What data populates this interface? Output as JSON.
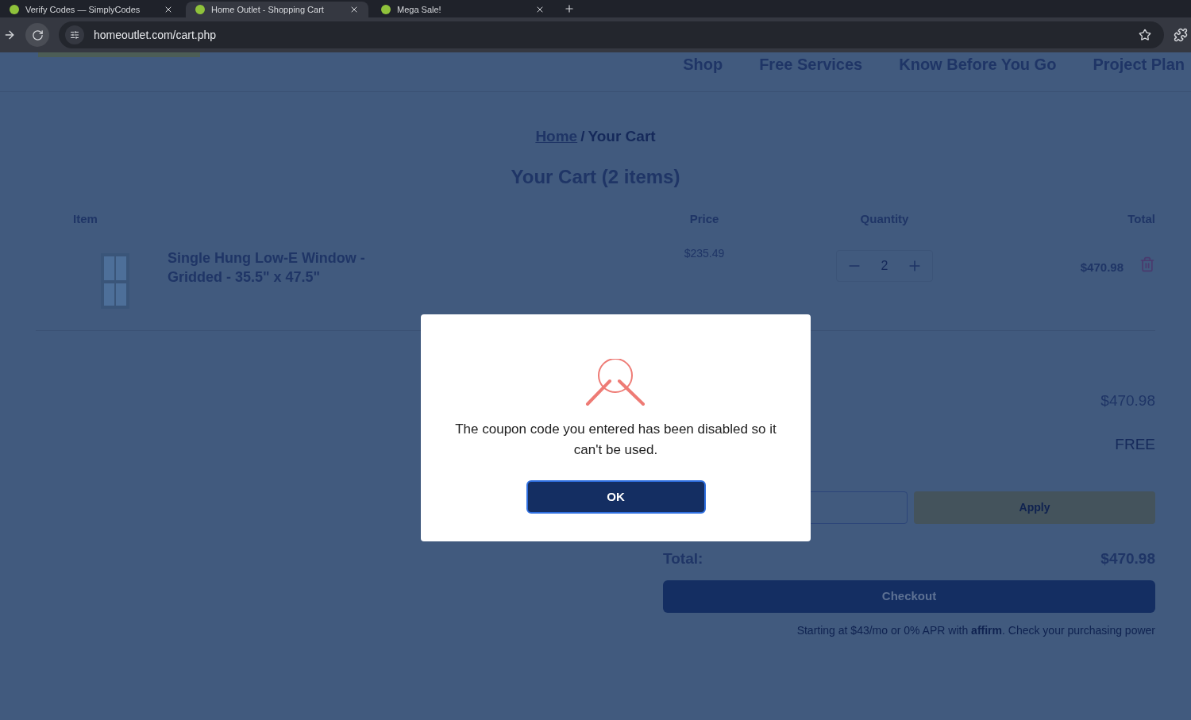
{
  "browser": {
    "tabs": [
      {
        "title": "Verify Codes — SimplyCodes",
        "selected": false
      },
      {
        "title": "Home Outlet - Shopping Cart",
        "selected": true
      },
      {
        "title": "Mega Sale!",
        "selected": false
      }
    ],
    "url": "homeoutlet.com/cart.php"
  },
  "nav": [
    "Shop",
    "Free Services",
    "Know Before You Go",
    "Project Plan"
  ],
  "breadcrumb": {
    "home": "Home",
    "separator": "/",
    "current": "Your Cart"
  },
  "title": "Your Cart (2 items)",
  "table": {
    "columns": [
      "Item",
      "Price",
      "Quantity",
      "Total"
    ],
    "rows": [
      {
        "name": "Single Hung Low-E Window - Gridded - 35.5\" x 47.5\"",
        "price": "$235.49",
        "quantity": "2",
        "total": "$470.98"
      }
    ]
  },
  "summary": {
    "subtotal": "$470.98",
    "shipping": "FREE",
    "apply": "Apply",
    "total_label": "Total:",
    "total": "$470.98",
    "checkout": "Checkout",
    "financing": "Starting at $43/mo or 0% APR with **affirm**. Check your purchasing power"
  },
  "dialog": {
    "message": "The coupon code you entered has been disabled so it can't be used.",
    "button": "OK"
  }
}
